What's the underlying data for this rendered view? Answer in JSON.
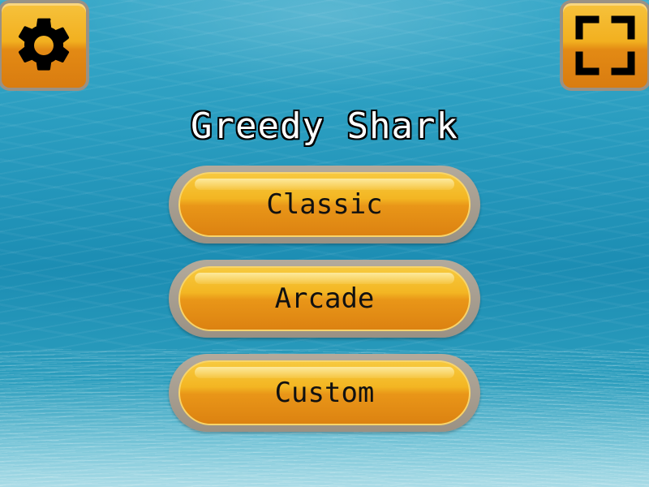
{
  "game": {
    "title": "Greedy Shark"
  },
  "menu": {
    "buttons": [
      {
        "label": "Classic"
      },
      {
        "label": "Arcade"
      },
      {
        "label": "Custom"
      }
    ]
  },
  "toolbar": {
    "settings_icon": "gear-icon",
    "fullscreen_icon": "fullscreen-icon"
  },
  "colors": {
    "button_orange": "#f2b020",
    "button_frame": "#9a9184",
    "water": "#2a9dc0",
    "title_text": "#ffffff",
    "title_outline": "#000000"
  }
}
